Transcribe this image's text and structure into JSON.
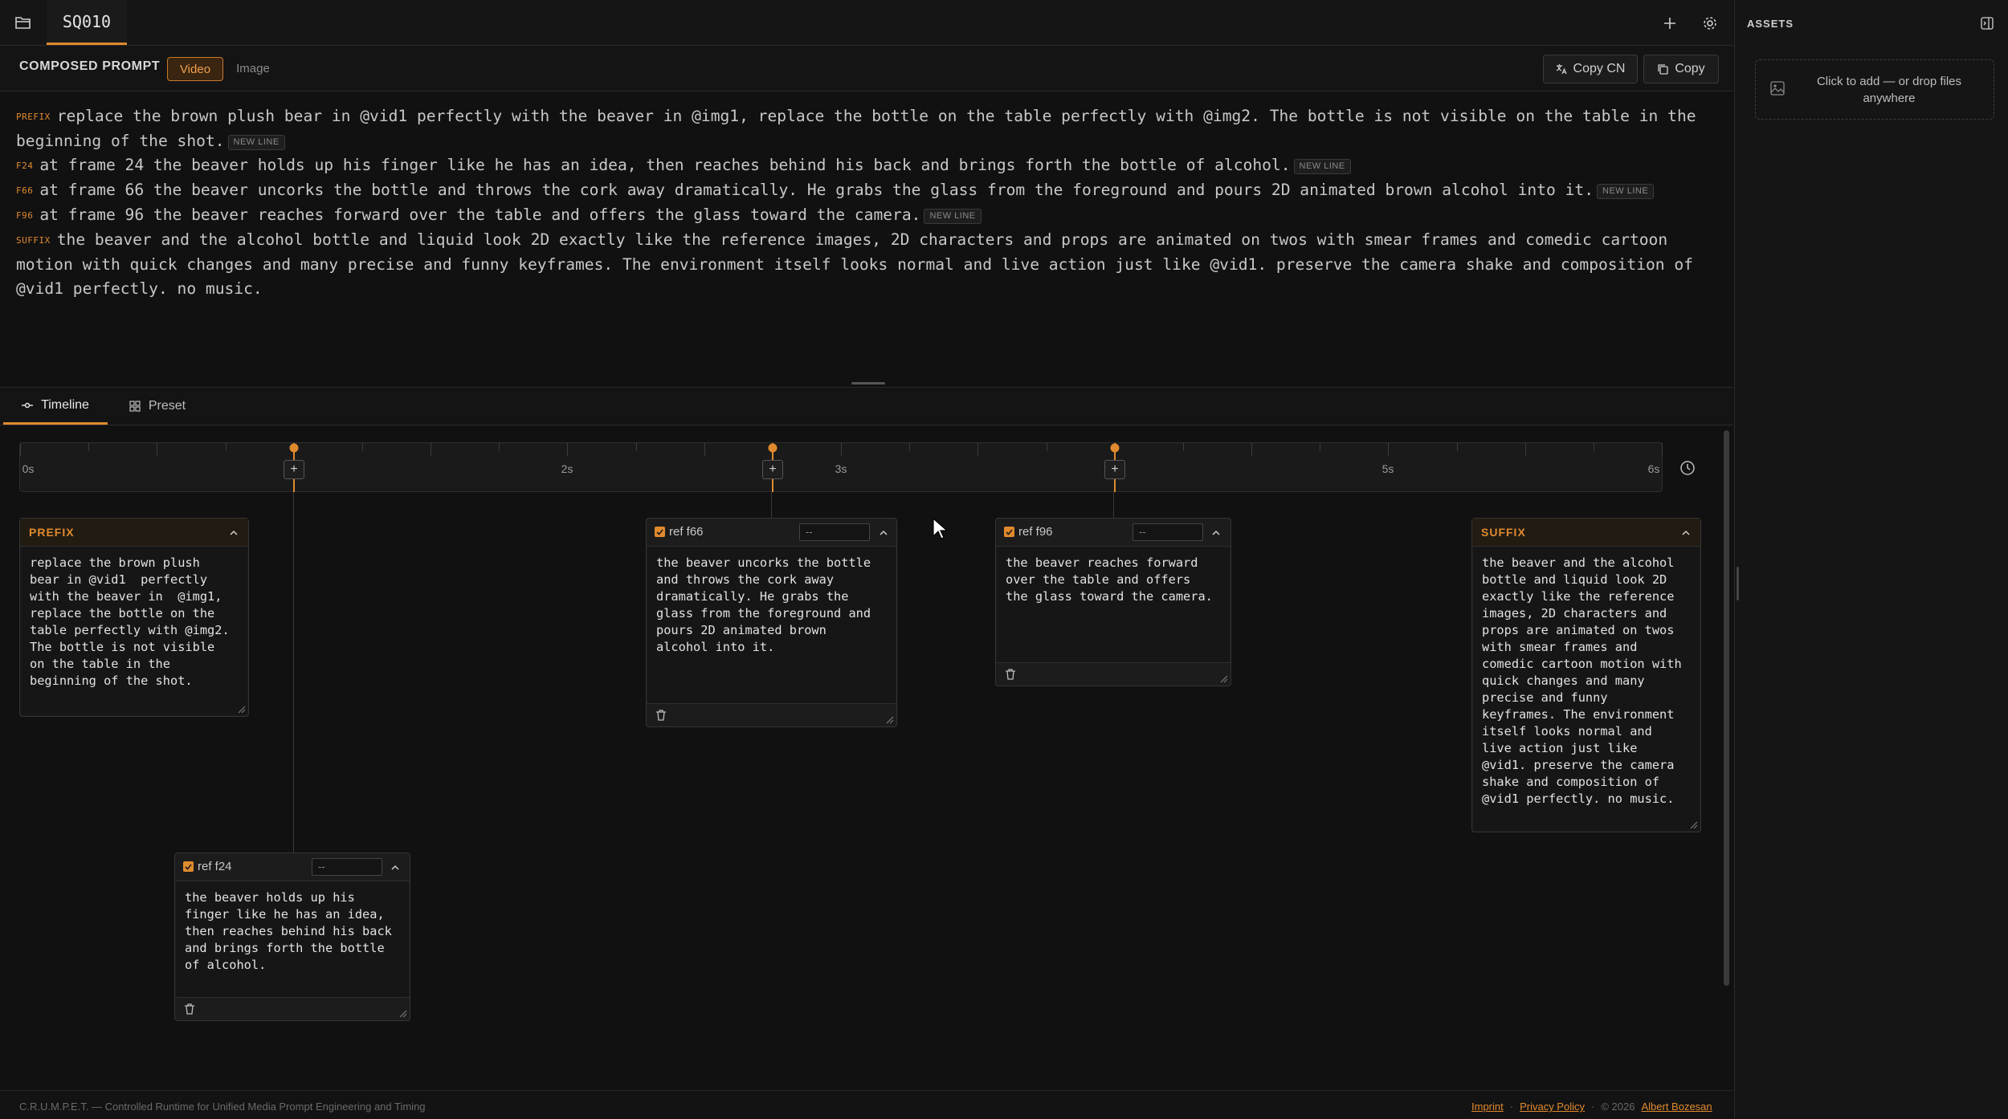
{
  "topbar": {
    "tab_label": "SQ010"
  },
  "prompt": {
    "header_title": "COMPOSED PROMPT",
    "mode_video": "Video",
    "mode_image": "Image",
    "copy_cn_label": "Copy CN",
    "copy_label": "Copy",
    "new_line_tag": "NEW LINE",
    "lines": [
      {
        "tag": "PREFIX",
        "text": "replace the brown plush bear in @vid1  perfectly with the beaver in  @img1, replace the bottle on the table perfectly with @img2. The bottle is not visible on the table in the beginning of the shot.",
        "new_line": true
      },
      {
        "tag": "F24",
        "text": "at frame 24 the beaver holds up his finger like he has an idea, then reaches behind his back and brings forth the bottle of alcohol.",
        "new_line": true
      },
      {
        "tag": "F66",
        "text": "at frame 66 the beaver uncorks the bottle and throws the cork away dramatically. He grabs the glass from the foreground and pours 2D animated brown alcohol into it.",
        "new_line": true
      },
      {
        "tag": "F96",
        "text": "at frame 96 the beaver reaches forward over the table and offers the glass toward the camera.",
        "new_line": true
      },
      {
        "tag": "SUFFIX",
        "text": "the beaver and the alcohol bottle and liquid look 2D exactly like the reference images, 2D characters and props are animated on twos with smear frames and comedic cartoon motion with quick changes and many precise and funny keyframes. The environment itself looks normal and live action just like @vid1. preserve the camera shake and composition of @vid1 perfectly. no music.",
        "new_line": false
      }
    ]
  },
  "tabs": {
    "timeline": "Timeline",
    "preset": "Preset"
  },
  "timeline": {
    "max_seconds": 6,
    "tick_labels": [
      {
        "t": 0,
        "label": "0s"
      },
      {
        "t": 2,
        "label": "2s"
      },
      {
        "t": 3,
        "label": "3s"
      },
      {
        "t": 5,
        "label": "5s"
      },
      {
        "t": 6,
        "label": "6s"
      }
    ],
    "keyframes": [
      1,
      2.75,
      4
    ]
  },
  "cards": {
    "prefix": {
      "label": "PREFIX",
      "text": "replace the brown plush\nbear in @vid1  perfectly\nwith the beaver in  @img1,\nreplace the bottle on the\ntable perfectly with @img2.\nThe bottle is not visible\non the table in the\nbeginning of the shot."
    },
    "f24": {
      "ref": "ref f24",
      "select": "--",
      "text": "the beaver holds up his\nfinger like he has an idea,\nthen reaches behind his back\nand brings forth the bottle\nof alcohol."
    },
    "f66": {
      "ref": "ref f66",
      "select": "--",
      "text": "the beaver uncorks the bottle\nand throws the cork away\ndramatically. He grabs the\nglass from the foreground and\npours 2D animated brown\nalcohol into it."
    },
    "f96": {
      "ref": "ref f96",
      "select": "--",
      "text": "the beaver reaches forward\nover the table and offers\nthe glass toward the camera."
    },
    "suffix": {
      "label": "SUFFIX",
      "text": "the beaver and the alcohol\nbottle and liquid look 2D\nexactly like the reference\nimages, 2D characters and\nprops are animated on twos\nwith smear frames and\ncomedic cartoon motion with\nquick changes and many\nprecise and funny\nkeyframes. The environment\nitself looks normal and\nlive action just like\n@vid1. preserve the camera\nshake and composition of\n@vid1 perfectly. no music."
    }
  },
  "footer": {
    "left": "C.R.U.M.P.E.T. — Controlled Runtime for Unified Media Prompt Engineering and Timing",
    "imprint": "Imprint",
    "sep1": "·",
    "privacy": "Privacy Policy",
    "sep2": "·",
    "copyright": "© 2026",
    "author": "Albert Bozesan"
  },
  "assets": {
    "title": "ASSETS",
    "dropzone_text": "Click to add — or drop files anywhere"
  },
  "colors": {
    "accent": "#e08a2e",
    "background": "#111111"
  }
}
